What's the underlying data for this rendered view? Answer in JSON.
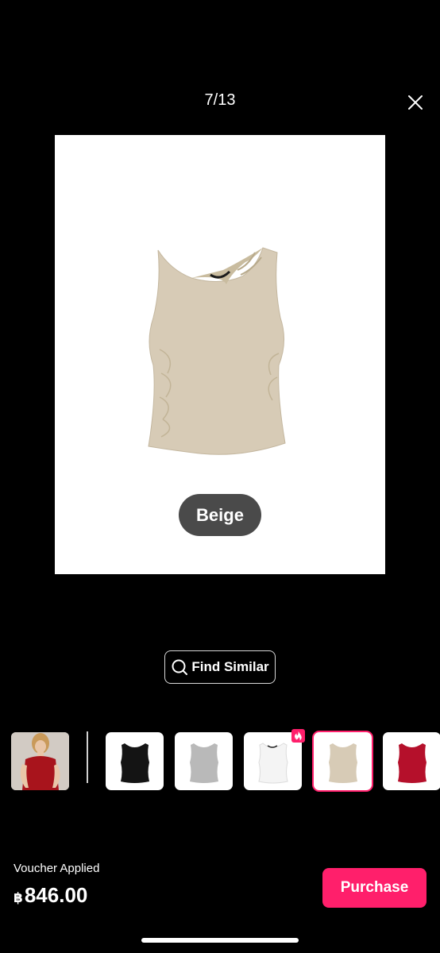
{
  "header": {
    "counter": "7/13"
  },
  "product_image": {
    "color_label": "Beige",
    "garment_color": "#d7cbb6"
  },
  "actions": {
    "find_similar_label": "Find Similar"
  },
  "variants": [
    {
      "name": "model-photo",
      "color": "#a8141c"
    },
    {
      "name": "black",
      "color": "#141414"
    },
    {
      "name": "grey",
      "color": "#b9b9b9"
    },
    {
      "name": "white",
      "color": "#f4f4f4"
    },
    {
      "name": "beige",
      "color": "#d7cbb6",
      "selected": true
    },
    {
      "name": "red",
      "color": "#b5102b"
    }
  ],
  "footer": {
    "voucher_text": "Voucher Applied",
    "currency": "฿",
    "price": "846.00",
    "purchase_label": "Purchase"
  },
  "colors": {
    "accent": "#ff1f6b",
    "background": "#000000"
  }
}
